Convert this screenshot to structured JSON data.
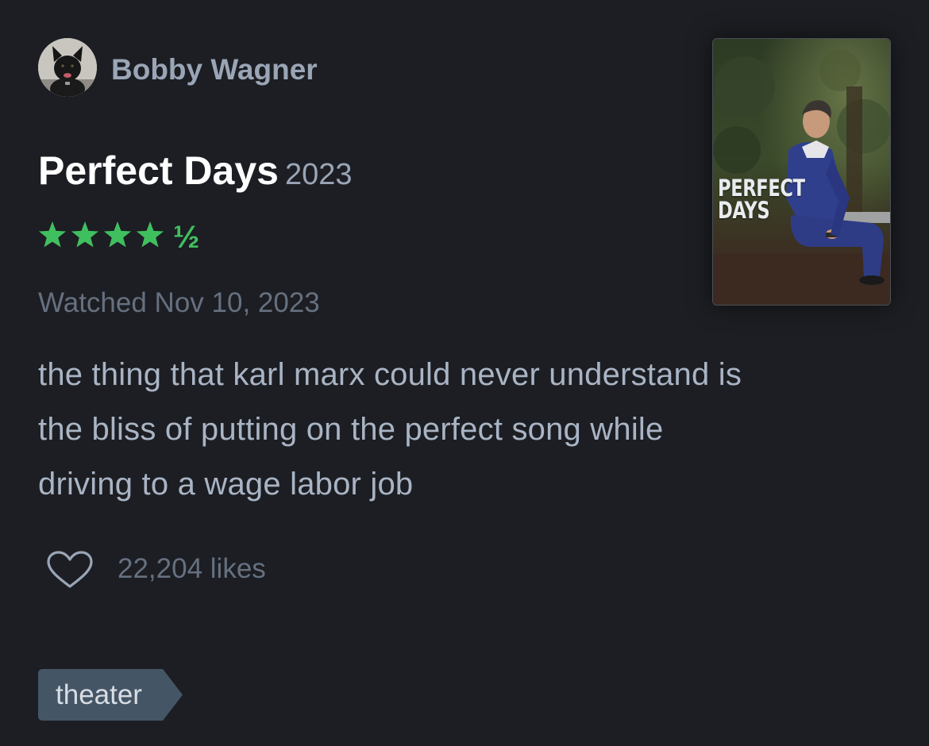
{
  "reviewer": {
    "name": "Bobby Wagner",
    "avatar_icon": "dog-avatar"
  },
  "film": {
    "title": "Perfect Days",
    "year": "2023",
    "poster_title_lines": [
      "PERFECT",
      "DAYS"
    ]
  },
  "rating": {
    "stars": 4.5,
    "max": 5,
    "color": "#40bf5f"
  },
  "watched": "Watched Nov 10, 2023",
  "review": {
    "lines": [
      "the thing that karl marx could never understand is",
      "the bliss of putting on the perfect song while",
      "driving to a wage labor job"
    ]
  },
  "likes": {
    "icon": "heart-icon",
    "label": "22,204 likes"
  },
  "tags": [
    {
      "label": "theater"
    }
  ],
  "colors": {
    "background": "#1c1e23",
    "muted_text": "#66707f",
    "body_text": "#a9b4c4",
    "name_text": "#9aa5b6",
    "tag_bg": "#445566"
  }
}
